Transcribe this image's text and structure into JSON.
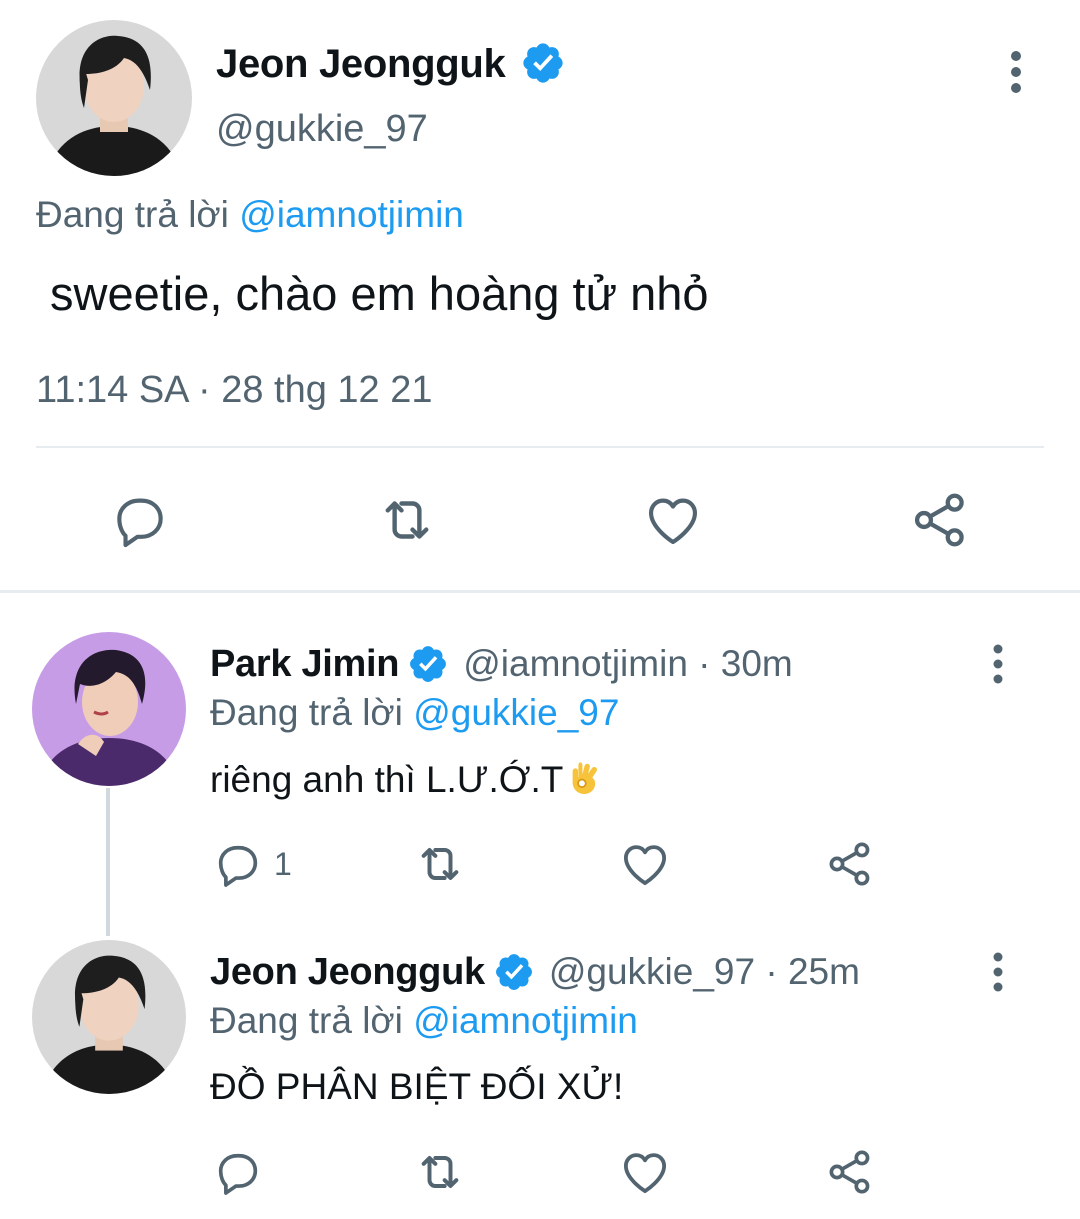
{
  "main_tweet": {
    "author_name": "Jeon Jeongguk",
    "author_handle": "@gukkie_97",
    "verified": true,
    "replying_prefix": "Đang trả lời",
    "replying_to": "@iamnotjimin",
    "text": "sweetie, chào em hoàng tử nhỏ",
    "timestamp": "11:14 SA · 28 thg 12 21",
    "actions": [
      "reply-icon",
      "retweet-icon",
      "like-icon",
      "share-icon"
    ],
    "more_icon": "more-vertical-icon"
  },
  "replies": [
    {
      "author_name": "Park Jimin",
      "verified": true,
      "meta": "@iamnotjimin · 30m",
      "replying_prefix": "Đang trả lời",
      "replying_to": "@gukkie_97",
      "text": "riêng anh thì L.Ư.Ớ.T",
      "emoji": "ok-hand",
      "reply_count": "1"
    },
    {
      "author_name": "Jeon Jeongguk",
      "verified": true,
      "meta": "@gukkie_97 · 25m",
      "replying_prefix": "Đang trả lời",
      "replying_to": "@iamnotjimin",
      "text": "ĐỒ PHÂN BIỆT ĐỐI XỬ!",
      "reply_count": ""
    }
  ],
  "colors": {
    "accent": "#1d9bf0",
    "secondary_text": "#536471",
    "divider": "#e6ecf0",
    "thread_line": "#cfd9de"
  }
}
